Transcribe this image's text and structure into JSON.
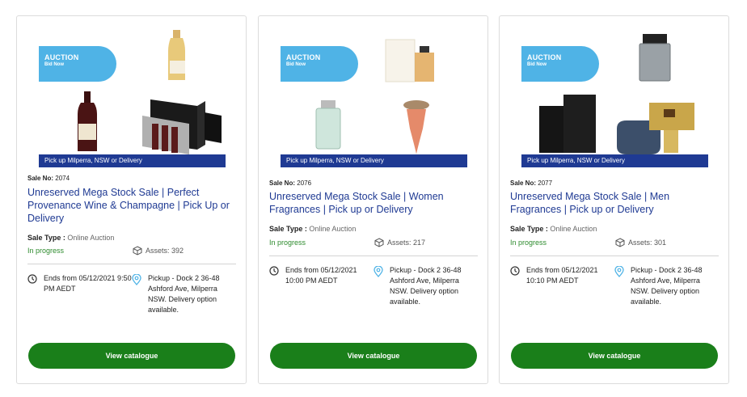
{
  "cards": [
    {
      "banner": {
        "auction_label": "AUCTION",
        "bid_label": "Bid Now",
        "pickup_strip": "Pick up Milperra, NSW or Delivery"
      },
      "sale_no_label": "Sale No:",
      "sale_no": "2074",
      "title": "Unreserved Mega Stock Sale | Perfect Provenance Wine & Champagne | Pick Up or Delivery",
      "sale_type_label": "Sale Type :",
      "sale_type": "Online Auction",
      "status": "In progress",
      "assets": "Assets: 392",
      "ends": "Ends from 05/12/2021 9:50 PM AEDT",
      "pickup": "Pickup - Dock 2 36-48 Ashford Ave, Milperra NSW. Delivery option available.",
      "button": "View catalogue"
    },
    {
      "banner": {
        "auction_label": "AUCTION",
        "bid_label": "Bid Now",
        "pickup_strip": "Pick up Milperra, NSW or Delivery"
      },
      "sale_no_label": "Sale No:",
      "sale_no": "2076",
      "title": "Unreserved Mega Stock Sale | Women Fragrances | Pick up or Delivery",
      "sale_type_label": "Sale Type :",
      "sale_type": "Online Auction",
      "status": "In progress",
      "assets": "Assets: 217",
      "ends": "Ends from 05/12/2021 10:00 PM AEDT",
      "pickup": "Pickup - Dock 2 36-48 Ashford Ave, Milperra NSW. Delivery option available.",
      "button": "View catalogue"
    },
    {
      "banner": {
        "auction_label": "AUCTION",
        "bid_label": "Bid Now",
        "pickup_strip": "Pick up Milperra, NSW or Delivery"
      },
      "sale_no_label": "Sale No:",
      "sale_no": "2077",
      "title": "Unreserved Mega Stock Sale | Men Fragrances | Pick up or Delivery",
      "sale_type_label": "Sale Type :",
      "sale_type": "Online Auction",
      "status": "In progress",
      "assets": "Assets: 301",
      "ends": "Ends from 05/12/2021 10:10 PM AEDT",
      "pickup": "Pickup - Dock 2 36-48 Ashford Ave, Milperra NSW. Delivery option available.",
      "button": "View catalogue"
    }
  ],
  "colors": {
    "accent_blue": "#1f3a93",
    "pill_blue": "#4fb3e6",
    "button_green": "#1a7f1a",
    "status_green": "#2e8b2e"
  },
  "icons": {
    "clock": "clock-icon",
    "pin": "map-pin-icon",
    "box": "box-icon"
  }
}
